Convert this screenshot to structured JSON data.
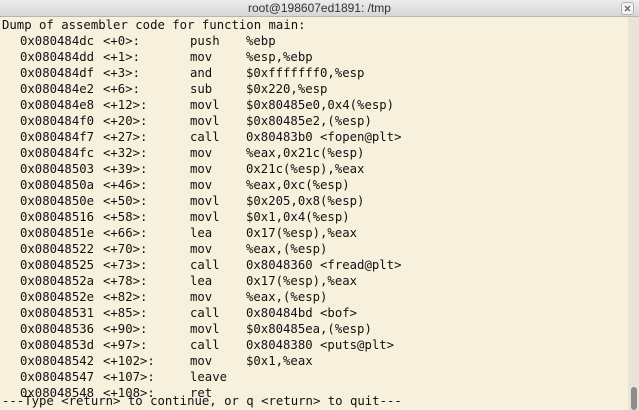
{
  "window": {
    "title": "root@198607ed1891: /tmp"
  },
  "terminal": {
    "header": "Dump of assembler code for function main:",
    "rows": [
      {
        "addr": "0x080484dc",
        "off": "<+0>:",
        "op": "push",
        "args": "%ebp"
      },
      {
        "addr": "0x080484dd",
        "off": "<+1>:",
        "op": "mov",
        "args": "%esp,%ebp"
      },
      {
        "addr": "0x080484df",
        "off": "<+3>:",
        "op": "and",
        "args": "$0xfffffff0,%esp"
      },
      {
        "addr": "0x080484e2",
        "off": "<+6>:",
        "op": "sub",
        "args": "$0x220,%esp"
      },
      {
        "addr": "0x080484e8",
        "off": "<+12>:",
        "op": "movl",
        "args": "$0x80485e0,0x4(%esp)"
      },
      {
        "addr": "0x080484f0",
        "off": "<+20>:",
        "op": "movl",
        "args": "$0x80485e2,(%esp)"
      },
      {
        "addr": "0x080484f7",
        "off": "<+27>:",
        "op": "call",
        "args": "0x80483b0 <fopen@plt>"
      },
      {
        "addr": "0x080484fc",
        "off": "<+32>:",
        "op": "mov",
        "args": "%eax,0x21c(%esp)"
      },
      {
        "addr": "0x08048503",
        "off": "<+39>:",
        "op": "mov",
        "args": "0x21c(%esp),%eax"
      },
      {
        "addr": "0x0804850a",
        "off": "<+46>:",
        "op": "mov",
        "args": "%eax,0xc(%esp)"
      },
      {
        "addr": "0x0804850e",
        "off": "<+50>:",
        "op": "movl",
        "args": "$0x205,0x8(%esp)"
      },
      {
        "addr": "0x08048516",
        "off": "<+58>:",
        "op": "movl",
        "args": "$0x1,0x4(%esp)"
      },
      {
        "addr": "0x0804851e",
        "off": "<+66>:",
        "op": "lea",
        "args": "0x17(%esp),%eax"
      },
      {
        "addr": "0x08048522",
        "off": "<+70>:",
        "op": "mov",
        "args": "%eax,(%esp)"
      },
      {
        "addr": "0x08048525",
        "off": "<+73>:",
        "op": "call",
        "args": "0x8048360 <fread@plt>"
      },
      {
        "addr": "0x0804852a",
        "off": "<+78>:",
        "op": "lea",
        "args": "0x17(%esp),%eax"
      },
      {
        "addr": "0x0804852e",
        "off": "<+82>:",
        "op": "mov",
        "args": "%eax,(%esp)"
      },
      {
        "addr": "0x08048531",
        "off": "<+85>:",
        "op": "call",
        "args": "0x80484bd <bof>"
      },
      {
        "addr": "0x08048536",
        "off": "<+90>:",
        "op": "movl",
        "args": "$0x80485ea,(%esp)"
      },
      {
        "addr": "0x0804853d",
        "off": "<+97>:",
        "op": "call",
        "args": "0x8048380 <puts@plt>"
      },
      {
        "addr": "0x08048542",
        "off": "<+102>:",
        "op": "mov",
        "args": "$0x1,%eax"
      },
      {
        "addr": "0x08048547",
        "off": "<+107>:",
        "op": "leave",
        "args": ""
      },
      {
        "addr": "0x08048548",
        "off": "<+108>:",
        "op": "ret",
        "args": ""
      }
    ],
    "prompt": "---Type <return> to continue, or q <return> to quit---"
  },
  "icons": {
    "close": "close-icon"
  },
  "colors": {
    "background": "#f6f0dd",
    "text": "#111111",
    "titlebar": "#e3e3e3"
  }
}
